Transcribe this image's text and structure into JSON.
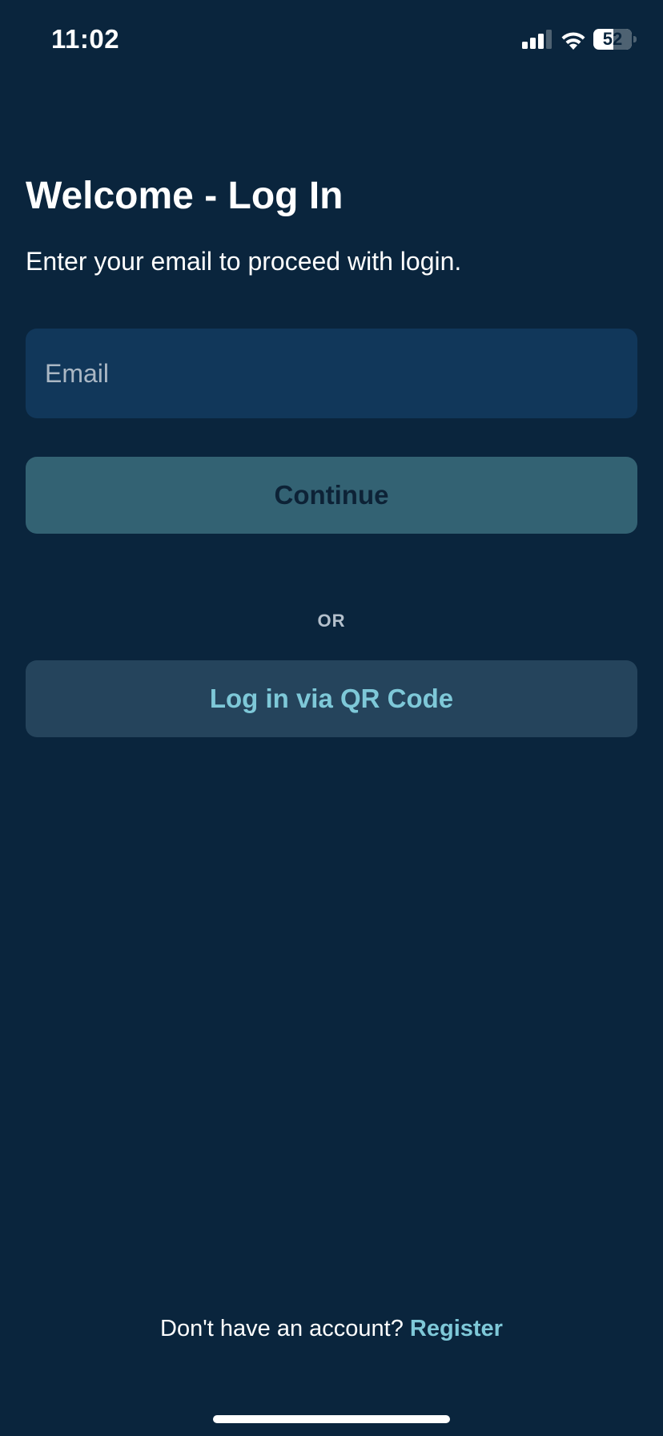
{
  "status_bar": {
    "time": "11:02",
    "battery_level": "52",
    "battery_fraction": 0.52,
    "icons": [
      "signal-icon",
      "wifi-icon",
      "battery-icon"
    ]
  },
  "login": {
    "title": "Welcome - Log In",
    "subtitle": "Enter your email to proceed with login.",
    "email_placeholder": "Email",
    "continue_label": "Continue",
    "divider": "OR",
    "qr_login_label": "Log in via QR Code"
  },
  "footer": {
    "prompt": "Don't have an account?",
    "register_label": "Register"
  },
  "colors": {
    "background": "#0a253d",
    "input_background": "#11375a",
    "continue_button": "#336273",
    "qr_button": "#25445c",
    "accent": "#7ec8d8"
  }
}
